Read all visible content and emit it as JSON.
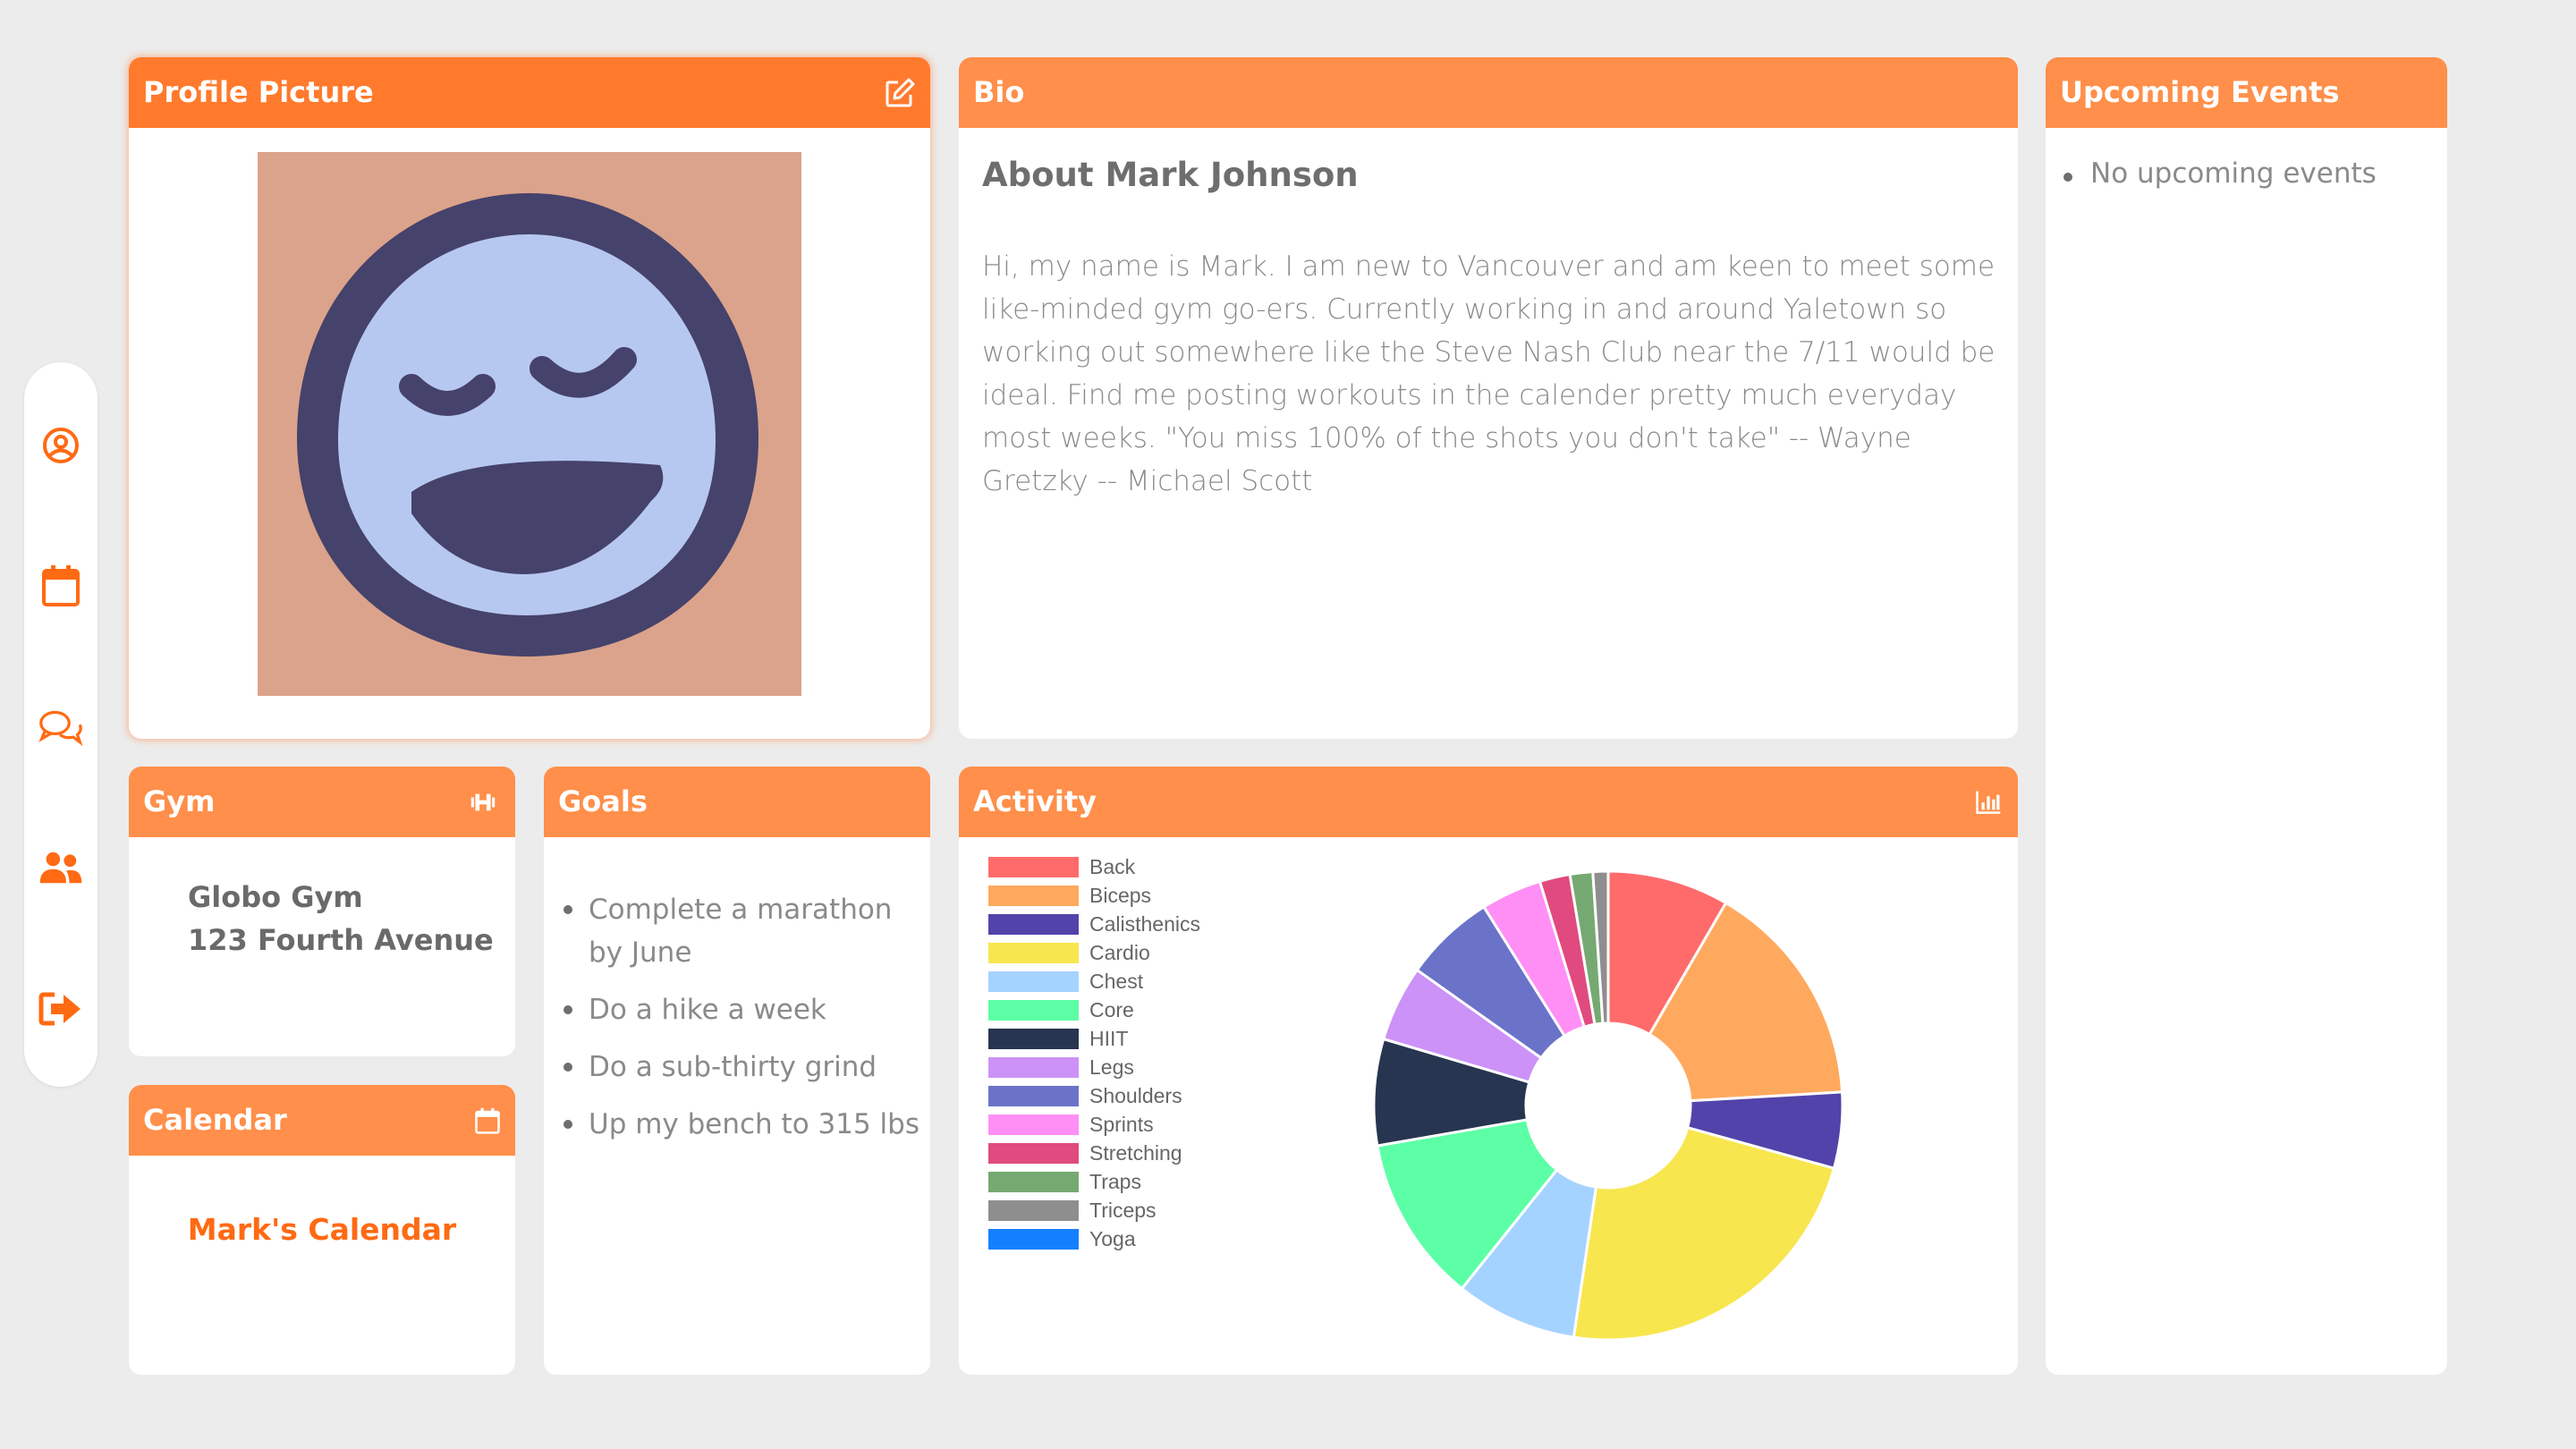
{
  "profile": {
    "title": "Profile Picture",
    "edit_icon": "edit-icon",
    "avatar_icon": "laughing-face-avatar"
  },
  "bio": {
    "title": "Bio",
    "heading": "About Mark Johnson",
    "text": "Hi, my name is Mark. I am new to Vancouver and am keen to meet some like-minded gym go-ers. Currently working in and around Yaletown so working out somewhere like the Steve Nash Club near the 7/11 would be ideal. Find me posting workouts in the calender pretty much everyday most weeks. \"You miss 100% of the shots you don't take\" -- Wayne Gretzky -- Michael Scott"
  },
  "events": {
    "title": "Upcoming Events",
    "items": [
      "No upcoming events"
    ]
  },
  "gym": {
    "title": "Gym",
    "icon": "dumbbell-icon",
    "name": "Globo Gym",
    "address": "123 Fourth Avenue"
  },
  "goals": {
    "title": "Goals",
    "items": [
      "Complete a marathon by June",
      "Do a hike a week",
      "Do a sub-thirty grind",
      "Up my bench to 315 lbs"
    ]
  },
  "calendar": {
    "title": "Calendar",
    "icon": "calendar-icon",
    "link": "Mark's Calendar"
  },
  "activity": {
    "title": "Activity",
    "icon": "bar-chart-icon"
  },
  "sidebar": {
    "items": [
      {
        "name": "profile",
        "icon": "user-circle-icon"
      },
      {
        "name": "calendar",
        "icon": "calendar-icon"
      },
      {
        "name": "messages",
        "icon": "chat-bubbles-icon"
      },
      {
        "name": "friends",
        "icon": "users-icon"
      },
      {
        "name": "logout",
        "icon": "sign-out-icon"
      }
    ]
  },
  "colors": {
    "accent": "#ff8f4a",
    "accent_strong": "#ff6a13",
    "background": "#ececec"
  },
  "chart_data": {
    "type": "pie",
    "donut": true,
    "legend": "left",
    "categories": [
      "Back",
      "Biceps",
      "Calisthenics",
      "Cardio",
      "Chest",
      "Core",
      "HIIT",
      "Legs",
      "Shoulders",
      "Sprints",
      "Stretching",
      "Traps",
      "Triceps",
      "Yoga"
    ],
    "values": [
      8,
      15,
      5,
      22,
      8,
      11,
      7,
      5,
      6,
      4,
      2,
      1.5,
      1,
      0
    ],
    "colors": [
      "#ff6b6b",
      "#ffa95e",
      "#5243aa",
      "#f8e64e",
      "#a5d3ff",
      "#5dffa6",
      "#283550",
      "#cc92f7",
      "#6b73c9",
      "#ff8ff5",
      "#e04a7f",
      "#76a971",
      "#8e8e8e",
      "#1580ff"
    ]
  }
}
